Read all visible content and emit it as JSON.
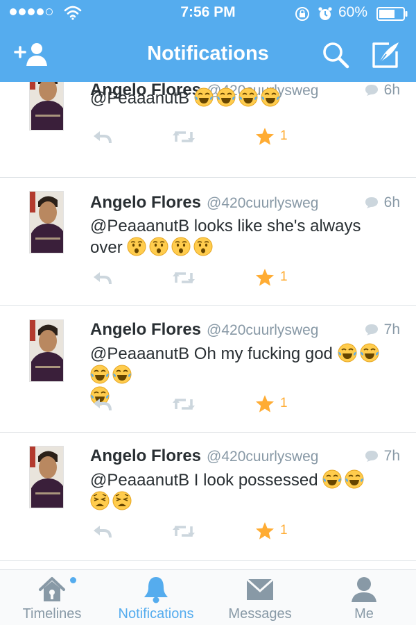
{
  "status_bar": {
    "time": "7:56 PM",
    "battery": "60%"
  },
  "nav": {
    "title": "Notifications"
  },
  "tweets": [
    {
      "name": "Angelo Flores",
      "handle": "@420cuurlysweg",
      "time": "6h",
      "text": "@PeaaanutB",
      "emojis": [
        "joy",
        "joy",
        "joy",
        "joy"
      ],
      "favorites": "1"
    },
    {
      "name": "Angelo Flores",
      "handle": "@420cuurlysweg",
      "time": "6h",
      "text": "@PeaaanutB looks like she's always over",
      "emojis": [
        "hushed",
        "hushed",
        "hushed",
        "hushed"
      ],
      "favorites": "1"
    },
    {
      "name": "Angelo Flores",
      "handle": "@420cuurlysweg",
      "time": "7h",
      "text": "@PeaaanutB Oh my fucking god",
      "emojis": [
        "joy",
        "joy",
        "joy",
        "joy",
        "joy"
      ],
      "favorites": "1"
    },
    {
      "name": "Angelo Flores",
      "handle": "@420cuurlysweg",
      "time": "7h",
      "text": "@PeaaanutB I look possessed",
      "emojis": [
        "joy",
        "joy",
        "weary",
        "weary"
      ],
      "favorites": "1"
    }
  ],
  "tabs": [
    {
      "label": "Timelines",
      "icon": "home-icon"
    },
    {
      "label": "Notifications",
      "icon": "bell-icon",
      "active": true
    },
    {
      "label": "Messages",
      "icon": "envelope-icon"
    },
    {
      "label": "Me",
      "icon": "person-icon"
    }
  ],
  "colors": {
    "brand": "#55acee",
    "star": "#ffac33",
    "text": "#292f33",
    "muted": "#8899a6"
  }
}
